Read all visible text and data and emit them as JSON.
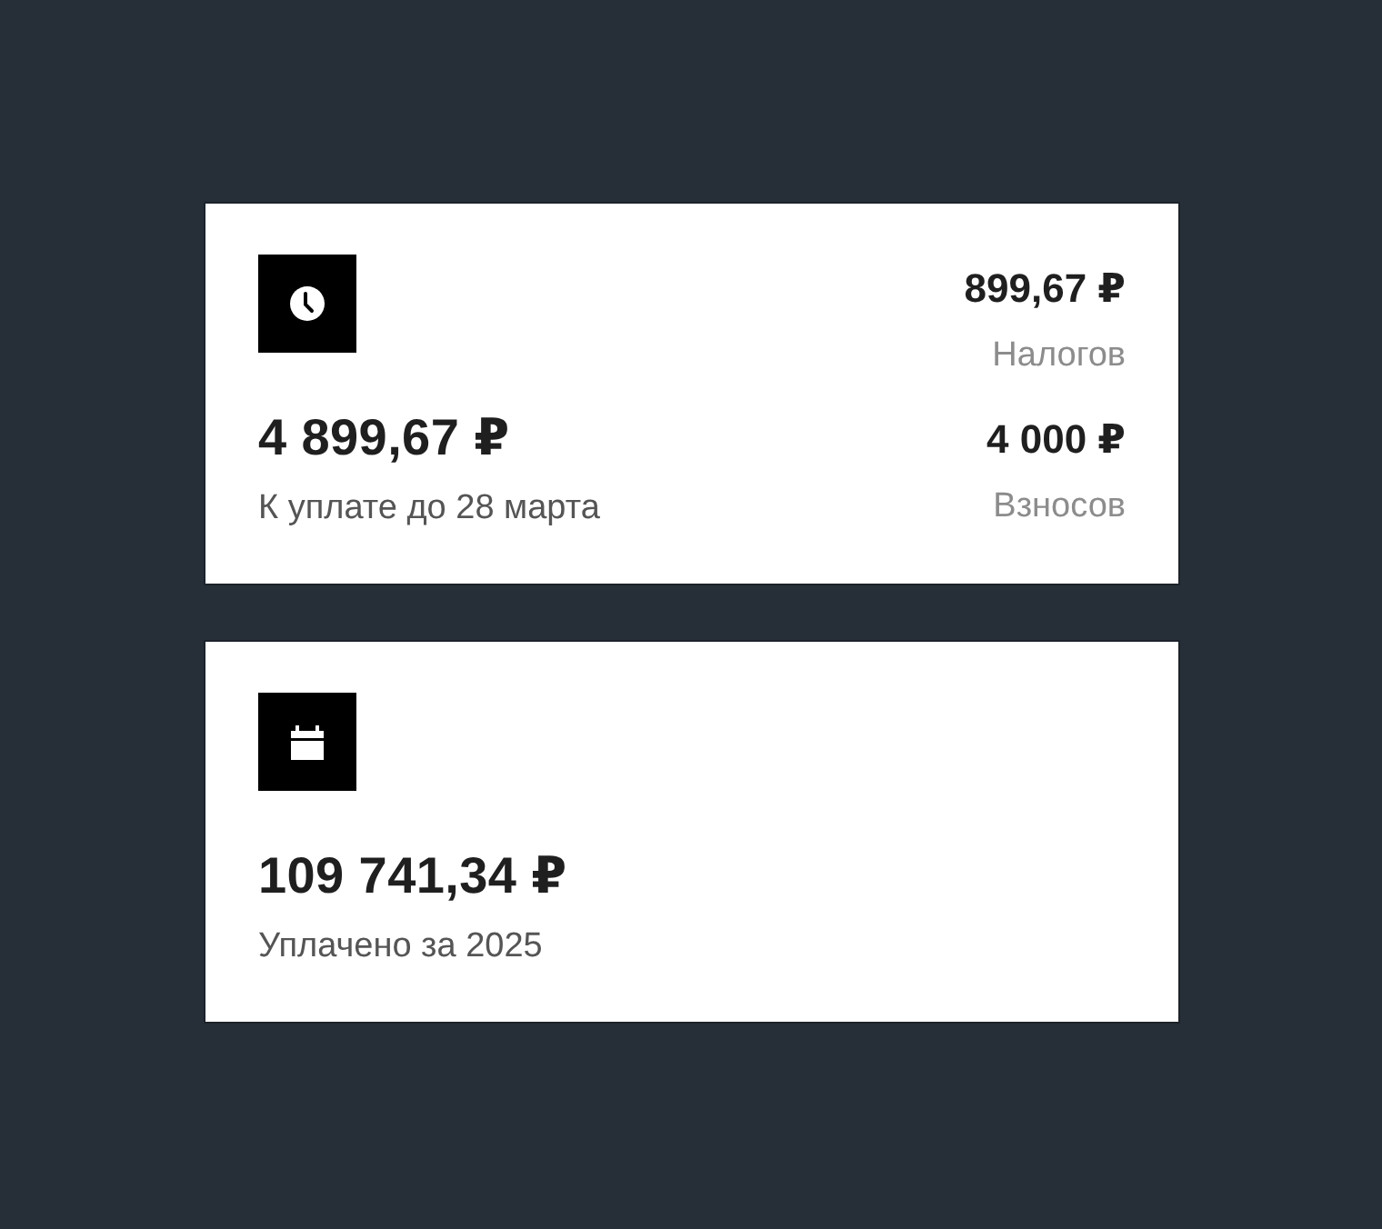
{
  "cards": [
    {
      "kind": "due",
      "amount": "4 899,67 ₽",
      "caption": "К уплате до 28 марта",
      "breakdown": [
        {
          "amount": "899,67 ₽",
          "label": "Налогов"
        },
        {
          "amount": "4 000 ₽",
          "label": "Взносов"
        }
      ]
    },
    {
      "kind": "paid",
      "amount": "109 741,34 ₽",
      "caption": "Уплачено за 2025"
    }
  ]
}
